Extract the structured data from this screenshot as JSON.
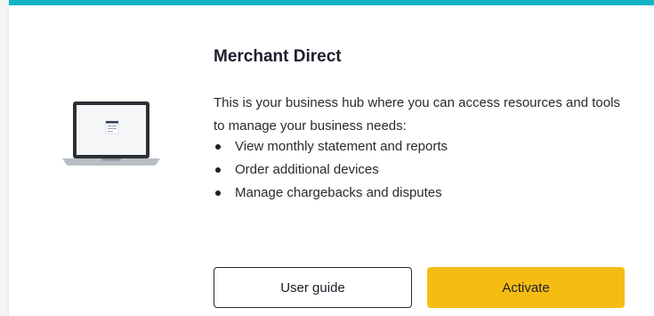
{
  "card": {
    "title": "Merchant Direct",
    "description": "This is your business hub where you can access resources and tools to manage your business needs:",
    "bullets": [
      "View monthly statement and reports",
      "Order additional devices",
      "Manage chargebacks and disputes"
    ],
    "illustration": "laptop-icon",
    "accent_color": "#14b4c7"
  },
  "buttons": {
    "user_guide": "User guide",
    "activate": "Activate",
    "activate_color": "#f5bd13"
  }
}
